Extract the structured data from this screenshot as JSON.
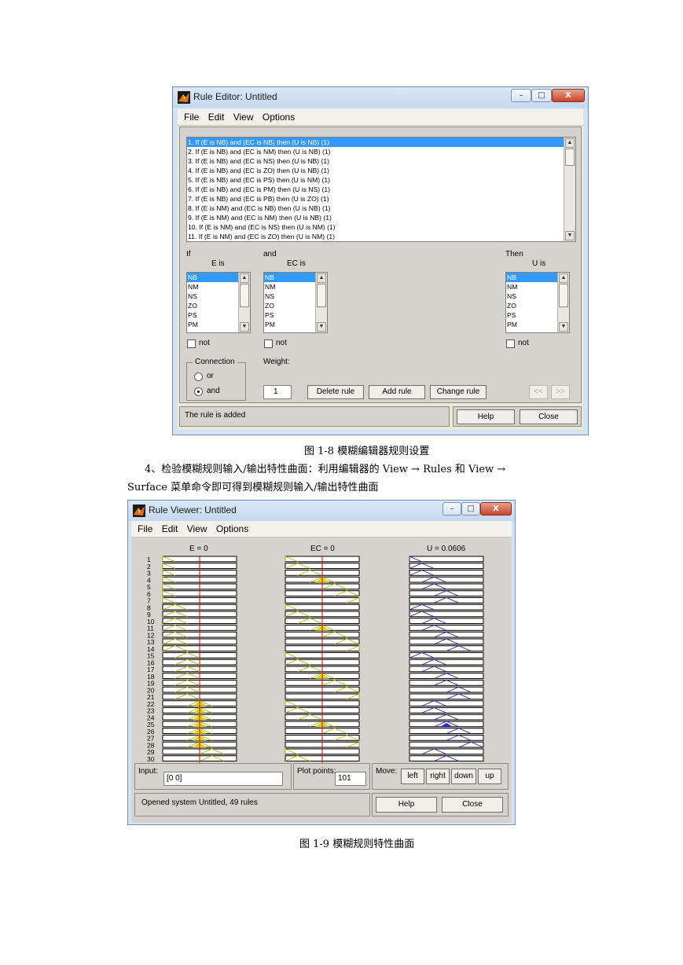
{
  "rule_editor": {
    "title": "Rule Editor: Untitled",
    "window_buttons": [
      "–",
      "□",
      "X"
    ],
    "menu": [
      "File",
      "Edit",
      "View",
      "Options"
    ],
    "rules": [
      "1. If (E is NB) and (EC is NB) then (U is NB) (1)",
      "2. If (E is NB) and (EC is NM) then (U is NB) (1)",
      "3. If (E is NB) and (EC is NS) then (U is NB) (1)",
      "4. If (E is NB) and (EC is ZO) then (U is NB) (1)",
      "5. If (E is NB) and (EC is PS) then (U is NM) (1)",
      "6. If (E is NB) and (EC is PM) then (U is NS) (1)",
      "7. If (E is NB) and (EC is PB) then (U is ZO) (1)",
      "8. If (E is NM) and (EC is NB) then (U is NB) (1)",
      "9. If (E is NM) and (EC is NM) then (U is NB) (1)",
      "10. If (E is NM) and (EC is NS) then (U is NM) (1)",
      "11. If (E is NM) and (EC is ZO) then (U is NM) (1)"
    ],
    "if_label": "If",
    "and_label": "and",
    "then_label": "Then",
    "e_label": "E is",
    "ec_label": "EC is",
    "u_label": "U is",
    "terms": [
      "NB",
      "NM",
      "NS",
      "ZO",
      "PS",
      "PM"
    ],
    "not_label": "not",
    "connection_label": "Connection",
    "or_label": "or",
    "and_option_label": "and",
    "connection_selected": "and",
    "weight_label": "Weight:",
    "weight_value": "1",
    "delete_rule": "Delete rule",
    "add_rule": "Add rule",
    "change_rule": "Change rule",
    "prev": "<<",
    "next": ">>",
    "status": "The rule is added",
    "help": "Help",
    "close": "Close"
  },
  "caption1": "图 1-8  模糊编辑器规则设置",
  "paragraph_line1": "4、检验模糊规则输入/输出特性曲面：利用编辑器的 View → Rules 和 View →",
  "paragraph_line2": "Surface 菜单命令即可得到模糊规则输入/输出特性曲面",
  "rule_viewer": {
    "title": "Rule Viewer: Untitled",
    "window_buttons": [
      "–",
      "□",
      "X"
    ],
    "menu": [
      "File",
      "Edit",
      "View",
      "Options"
    ],
    "col_e": "E = 0",
    "col_ec": "EC = 0",
    "col_u": "U = 0.0606",
    "rule_numbers": [
      "1",
      "2",
      "3",
      "4",
      "5",
      "6",
      "7",
      "8",
      "9",
      "10",
      "11",
      "12",
      "13",
      "14",
      "15",
      "16",
      "17",
      "18",
      "19",
      "20",
      "21",
      "22",
      "23",
      "24",
      "25",
      "26",
      "27",
      "28",
      "29",
      "30"
    ],
    "input_label": "Input:",
    "input_value": "[0 0]",
    "plot_points_label": "Plot points:",
    "plot_points_value": "101",
    "move_label": "Move:",
    "left": "left",
    "right": "right",
    "down": "down",
    "up": "up",
    "status": "Opened system Untitled, 49 rules",
    "help": "Help",
    "close": "Close",
    "colors": {
      "input_mf": "#b8b800",
      "fill": "#f0d000",
      "output_mf": "#1f1fa8",
      "output_fill": "#2b2bd9",
      "cursor": "#e00000"
    }
  },
  "caption2": "图 1-9  模糊规则特性曲面"
}
